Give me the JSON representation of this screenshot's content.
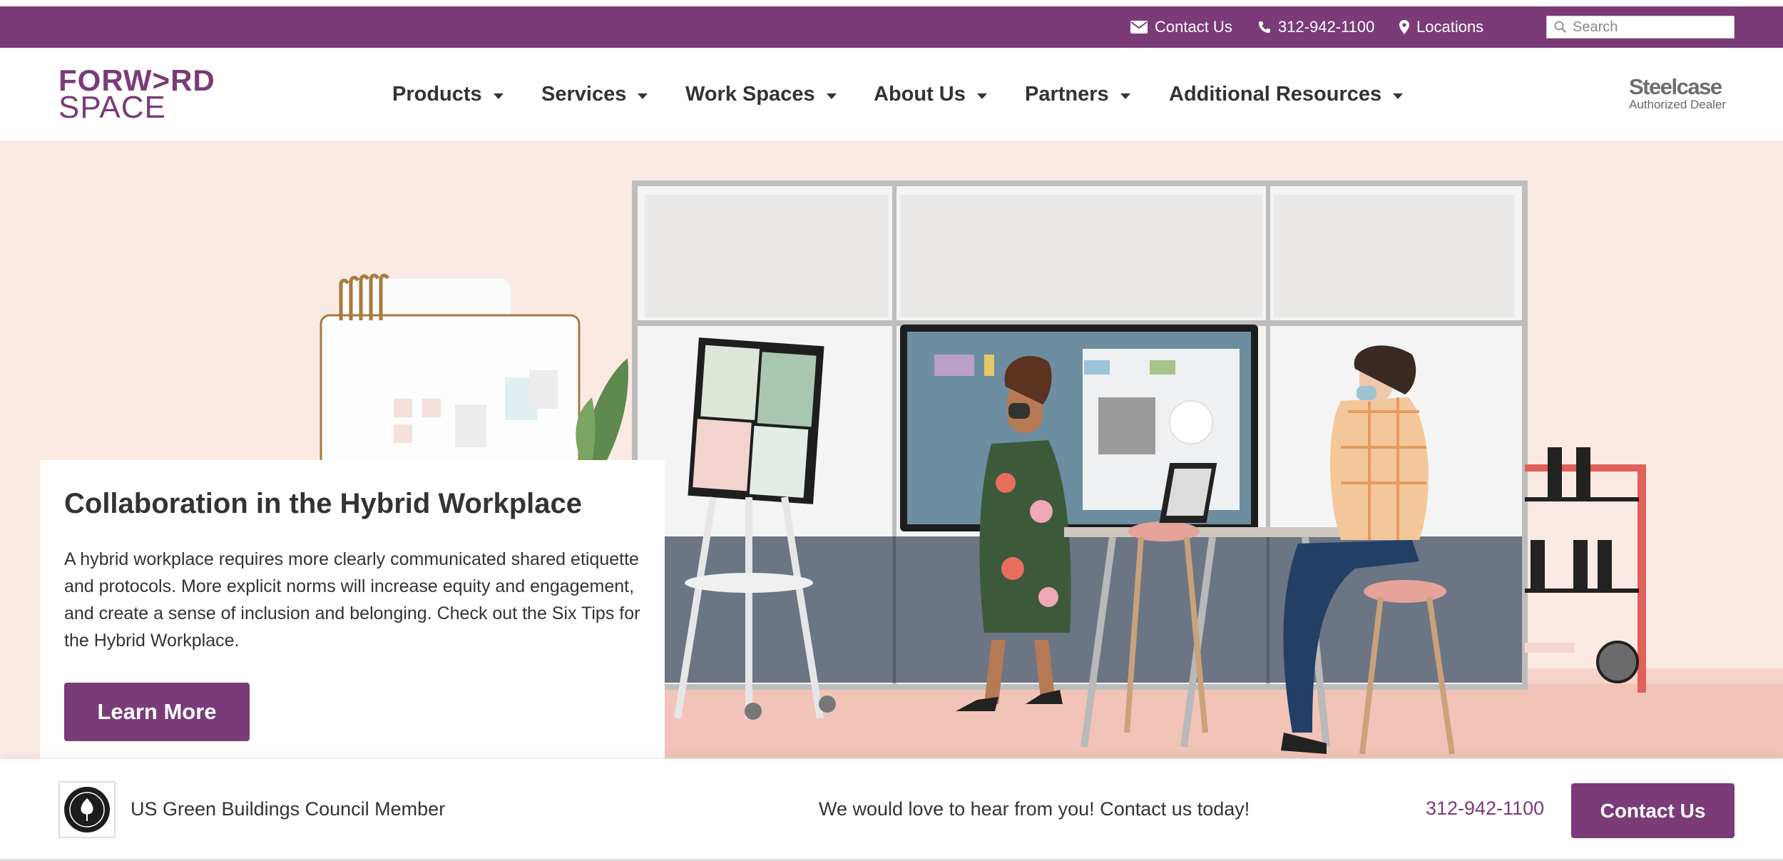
{
  "topbar": {
    "contact_label": "Contact Us",
    "phone_label": "312-942-1100",
    "locations_label": "Locations",
    "search_placeholder": "Search"
  },
  "header": {
    "logo_line1": "FORW>RD",
    "logo_line2": "SPACE",
    "nav": [
      {
        "label": "Products"
      },
      {
        "label": "Services"
      },
      {
        "label": "Work Spaces"
      },
      {
        "label": "About Us"
      },
      {
        "label": "Partners"
      },
      {
        "label": "Additional Resources"
      }
    ],
    "dealer_brand": "Steelcase",
    "dealer_sub": "Authorized Dealer"
  },
  "hero": {
    "title": "Collaboration in the Hybrid Workplace",
    "body": "A hybrid workplace requires more clearly communicated shared etiquette and protocols. More explicit norms will increase equity and engagement, and create a sense of inclusion and belonging. Check out the Six Tips for the Hybrid Workplace.",
    "button_label": "Learn More"
  },
  "bottombar": {
    "membership": "US Green Buildings Council Member",
    "cta_text": "We would love to hear from you! Contact us today!",
    "phone": "312-942-1100",
    "button_label": "Contact Us"
  },
  "colors": {
    "brand_purple": "#7a3b78",
    "hero_bg": "#fbe9e3"
  }
}
